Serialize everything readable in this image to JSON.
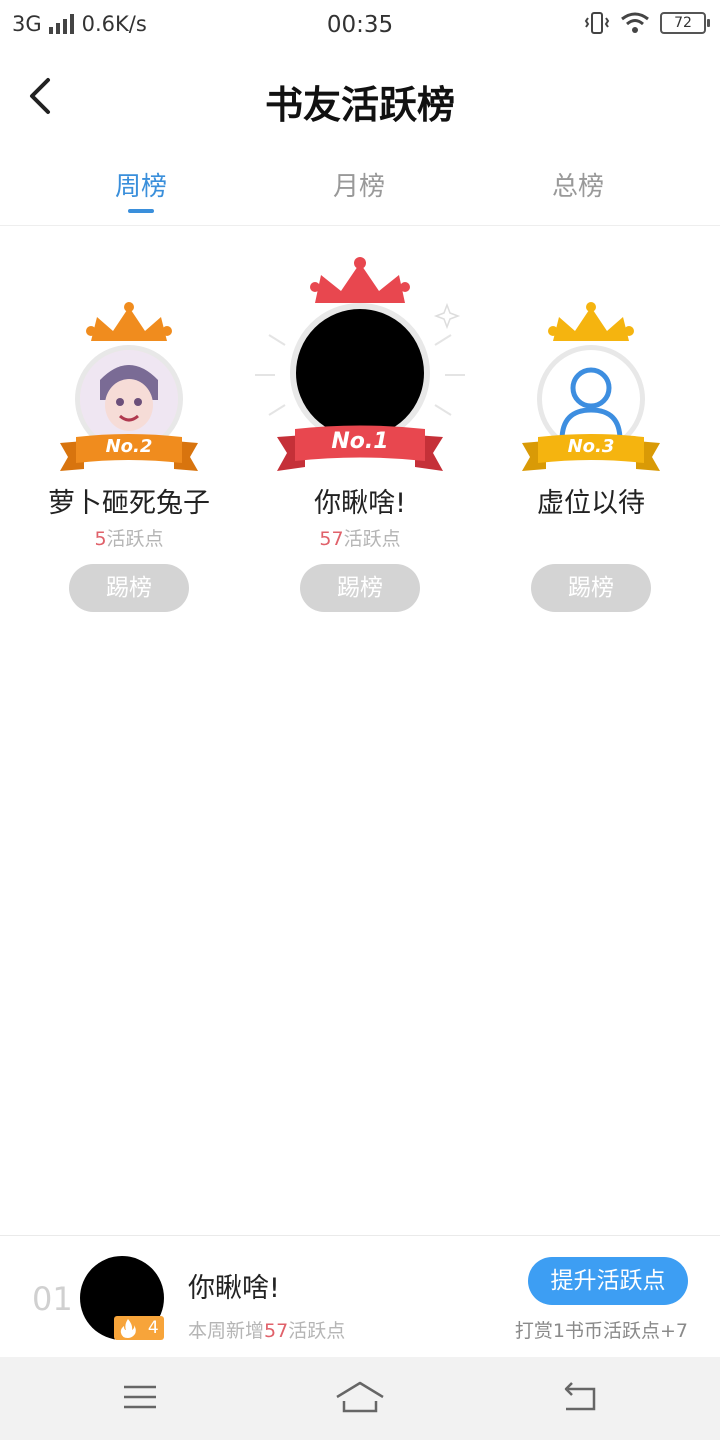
{
  "status_bar": {
    "network": "3G",
    "speed": "0.6K/s",
    "time": "00:35",
    "battery": "72"
  },
  "header": {
    "title": "书友活跃榜",
    "back_icon": "chevron-left-icon"
  },
  "tabs": [
    {
      "label": "周榜",
      "active": true
    },
    {
      "label": "月榜",
      "active": false
    },
    {
      "label": "总榜",
      "active": false
    }
  ],
  "podium": {
    "first": {
      "rank_label": "No.1",
      "name": "你瞅啥!",
      "points_value": "57",
      "points_suffix": "活跃点",
      "button": "踢榜",
      "color": "#e8474f"
    },
    "second": {
      "rank_label": "No.2",
      "name": "萝卜砸死兔子",
      "points_value": "5",
      "points_suffix": "活跃点",
      "button": "踢榜",
      "color": "#f08c1e"
    },
    "third": {
      "rank_label": "No.3",
      "name": "虚位以待",
      "button": "踢榜",
      "color": "#f5b40f"
    }
  },
  "my_rank": {
    "rank": "01",
    "name": "你瞅啥!",
    "badge": "4",
    "week_prefix": "本周新增",
    "week_value": "57",
    "week_suffix": "活跃点",
    "boost_button": "提升活跃点",
    "reward_hint": "打赏1书币活跃点+7"
  },
  "colors": {
    "accent": "#3a8fdb",
    "button_blue": "#3d9ef3",
    "points_red": "#e0616a",
    "kick_gray": "#d4d4d4"
  },
  "nav_bar": {
    "icons": [
      "menu-icon",
      "home-icon",
      "back-icon"
    ]
  }
}
